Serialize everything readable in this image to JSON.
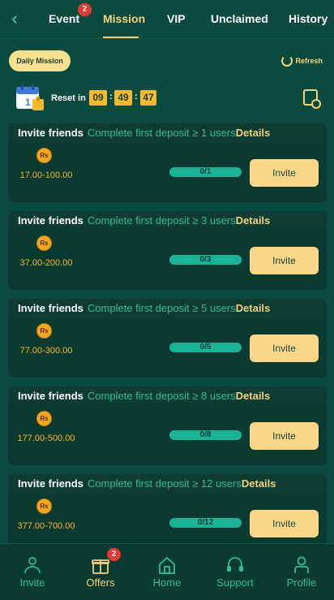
{
  "topnav": {
    "tabs": [
      {
        "label": "Event",
        "badge": "2"
      },
      {
        "label": "Mission"
      },
      {
        "label": "VIP"
      },
      {
        "label": "Unclaimed"
      },
      {
        "label": "History"
      }
    ],
    "active_tab": "Mission"
  },
  "daily_mission_label": "Daily Mission",
  "refresh_label": "Refresh",
  "reset": {
    "label": "Reset in",
    "hours": "09",
    "minutes": "49",
    "seconds": "47"
  },
  "missions": [
    {
      "title": "Invite friends",
      "desc": "Complete first deposit ≥ 1 users",
      "details": "Details",
      "currency": "Rs",
      "reward": "17.00-100.00",
      "progress": "0/1",
      "progress_value": 0,
      "button": "Invite"
    },
    {
      "title": "Invite friends",
      "desc": "Complete first deposit ≥ 3 users",
      "details": "Details",
      "currency": "Rs",
      "reward": "37.00-200.00",
      "progress": "0/3",
      "progress_value": 0,
      "button": "Invite"
    },
    {
      "title": "Invite friends",
      "desc": "Complete first deposit ≥ 5 users",
      "details": "Details",
      "currency": "Rs",
      "reward": "77.00-300.00",
      "progress": "0/5",
      "progress_value": 0,
      "button": "Invite"
    },
    {
      "title": "Invite friends",
      "desc": "Complete first deposit ≥ 8 users",
      "details": "Details",
      "currency": "Rs",
      "reward": "177.00-500.00",
      "progress": "0/8",
      "progress_value": 0,
      "button": "Invite"
    },
    {
      "title": "Invite friends",
      "desc": "Complete first deposit ≥ 12 users",
      "details": "Details",
      "currency": "Rs",
      "reward": "377.00-700.00",
      "progress": "0/12",
      "progress_value": 0,
      "button": "Invite"
    }
  ],
  "bottomnav": {
    "items": [
      {
        "label": "Invite",
        "icon": "users-icon"
      },
      {
        "label": "Offers",
        "icon": "gift-icon",
        "badge": "2",
        "active": true
      },
      {
        "label": "Home",
        "icon": "home-icon"
      },
      {
        "label": "Support",
        "icon": "headset-icon"
      },
      {
        "label": "Profile",
        "icon": "profile-icon"
      }
    ]
  },
  "colors": {
    "background": "#0b4a3e",
    "accent": "#f3d27a",
    "teal": "#2dbf9c",
    "badge": "#e53935"
  }
}
